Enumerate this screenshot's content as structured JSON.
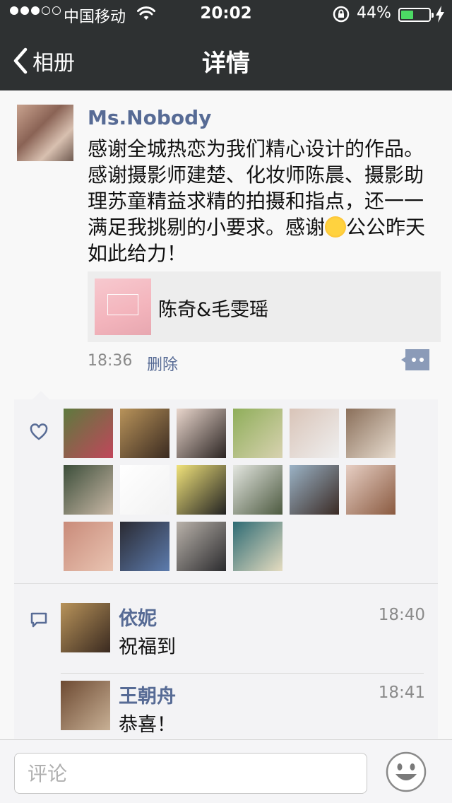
{
  "status_bar": {
    "carrier": "中国移动",
    "time": "20:02",
    "battery_percent": "44%",
    "battery_level": 0.44,
    "signal_strength": 3,
    "signal_total": 5
  },
  "nav": {
    "back_label": "相册",
    "title": "详情"
  },
  "post": {
    "author": "Ms.Nobody",
    "text_part1": "感谢全城热恋为我们精心设计的作品。感谢摄影师建楚、化妆师陈晨、摄影助理苏童精益求精的拍摄和指点，还一一满足我挑剔的小要求。感谢",
    "text_part2": "公公昨天如此给力！",
    "emoji": "sun-emoji",
    "link_title": "陈奇&毛雯瑶",
    "time": "18:36",
    "delete_label": "删除"
  },
  "likes": [
    {
      "name": "like-avatar-1",
      "colors": [
        "#5d7a3e",
        "#c1465b"
      ]
    },
    {
      "name": "like-avatar-2",
      "colors": [
        "#b8935a",
        "#3a2a20"
      ]
    },
    {
      "name": "like-avatar-3",
      "colors": [
        "#e9d6cc",
        "#2b2422"
      ]
    },
    {
      "name": "like-avatar-4",
      "colors": [
        "#8fae5a",
        "#d8d2b0"
      ]
    },
    {
      "name": "like-avatar-5",
      "colors": [
        "#d9c4b8",
        "#efefef"
      ]
    },
    {
      "name": "like-avatar-6",
      "colors": [
        "#8a6f5a",
        "#e8ddd0"
      ]
    },
    {
      "name": "like-avatar-7",
      "colors": [
        "#3c4e3a",
        "#c9b8a6"
      ]
    },
    {
      "name": "like-avatar-8",
      "colors": [
        "#ffffff",
        "#f2f2f2"
      ]
    },
    {
      "name": "like-avatar-9",
      "colors": [
        "#f0e27a",
        "#222222"
      ]
    },
    {
      "name": "like-avatar-10",
      "colors": [
        "#e3e6e0",
        "#4d5a40"
      ]
    },
    {
      "name": "like-avatar-11",
      "colors": [
        "#9bb3c6",
        "#3a2a24"
      ]
    },
    {
      "name": "like-avatar-12",
      "colors": [
        "#e7cfc4",
        "#8a5a40"
      ]
    },
    {
      "name": "like-avatar-13",
      "colors": [
        "#c98b7a",
        "#e9c4b2"
      ]
    },
    {
      "name": "like-avatar-14",
      "colors": [
        "#2a2a32",
        "#5d7cae"
      ]
    },
    {
      "name": "like-avatar-15",
      "colors": [
        "#b9b2aa",
        "#2b2b2e"
      ]
    },
    {
      "name": "like-avatar-16",
      "colors": [
        "#2e6b74",
        "#e5dcc0"
      ]
    }
  ],
  "comments": [
    {
      "name": "依妮",
      "text": "祝福到",
      "time": "18:40",
      "colors": [
        "#b8935a",
        "#3a2a20"
      ]
    },
    {
      "name": "王朝舟",
      "text": "恭喜！",
      "time": "18:41",
      "colors": [
        "#6d4a32",
        "#c8b095"
      ]
    }
  ],
  "comment_input": {
    "placeholder": "评论"
  },
  "icons": {
    "signal": "signal-dots-icon",
    "wifi": "wifi-icon",
    "lock": "rotation-lock-icon",
    "battery": "battery-icon",
    "charging": "charging-bolt-icon",
    "back": "chevron-left-icon",
    "like": "heart-icon",
    "comment": "comment-bubble-icon",
    "more": "more-options-icon",
    "emoji": "emoji-face-icon"
  },
  "colors": {
    "nav_bg": "#2e3132",
    "name_link": "#576b95",
    "battery_fill": "#4cd964",
    "panel_bg": "#f3f3f5"
  }
}
